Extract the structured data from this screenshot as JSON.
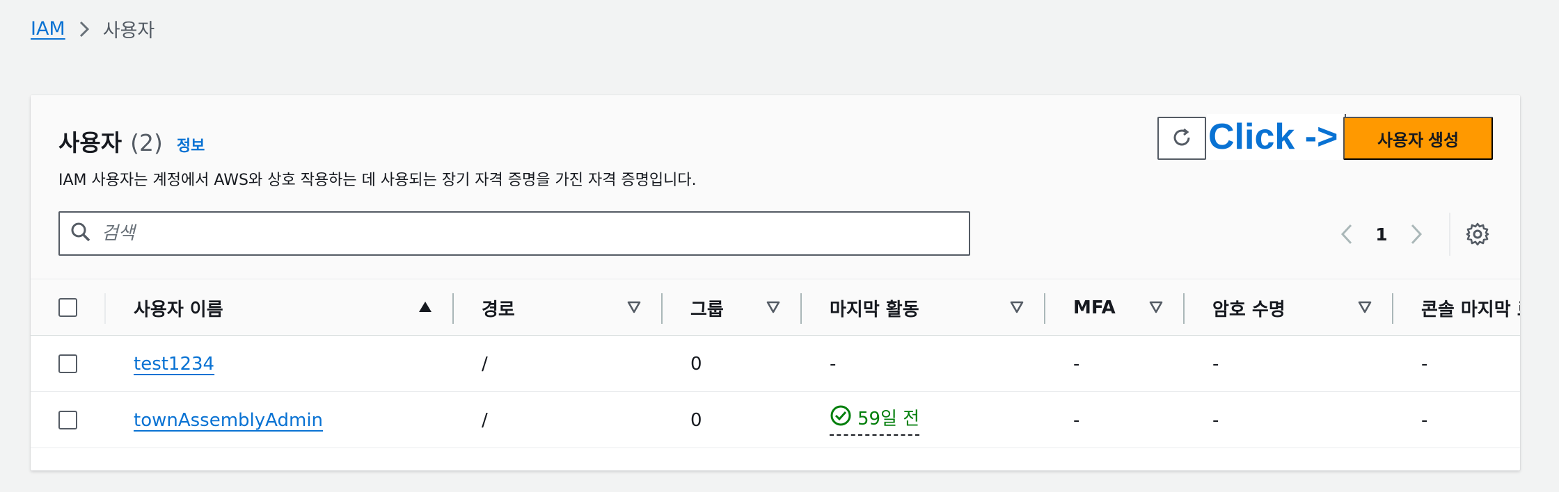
{
  "breadcrumb": {
    "root": "IAM",
    "current": "사용자"
  },
  "panel": {
    "title": "사용자",
    "count": "(2)",
    "info": "정보",
    "description": "IAM 사용자는 계정에서 AWS와 상호 작용하는 데 사용되는 장기 자격 증명을 가진 자격 증명입니다."
  },
  "annotation": "Click ->",
  "buttons": {
    "create": "사용자 생성"
  },
  "search": {
    "placeholder": "검색"
  },
  "pagination": {
    "current_page": "1"
  },
  "table": {
    "columns": [
      {
        "label": "사용자 이름",
        "sort": "ascending"
      },
      {
        "label": "경로",
        "sort": "none"
      },
      {
        "label": "그룹",
        "sort": "none"
      },
      {
        "label": "마지막 활동",
        "sort": "none"
      },
      {
        "label": "MFA",
        "sort": "none"
      },
      {
        "label": "암호 수명",
        "sort": "none"
      },
      {
        "label": "콘솔 마지막 로"
      }
    ],
    "rows": [
      {
        "name": "test1234",
        "path": "/",
        "groups": "0",
        "last_activity": "-",
        "mfa": "-",
        "password_age": "-",
        "console_last": "-"
      },
      {
        "name": "townAssemblyAdmin",
        "path": "/",
        "groups": "0",
        "last_activity": "59일 전",
        "mfa": "-",
        "password_age": "-",
        "console_last": "-"
      }
    ]
  },
  "colors": {
    "link": "#0972d3",
    "primary_button": "#ff9900",
    "success": "#037f0c",
    "background": "#f2f3f3"
  },
  "icons": [
    "chevron-right-icon",
    "refresh-icon",
    "search-icon",
    "chevron-left-icon",
    "settings-gear-icon",
    "sort-ascending-icon",
    "sort-icon",
    "check-circle-icon"
  ]
}
